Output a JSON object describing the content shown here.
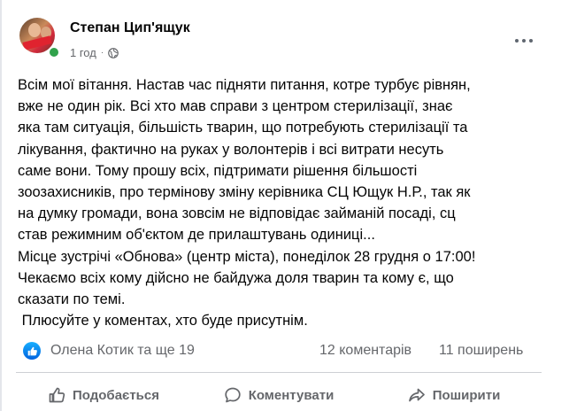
{
  "post": {
    "author": "Степан Цип'ящук",
    "time": "1 год",
    "time_separator": "·",
    "body_lines": [
      "Всім мої вітання. Настав час підняти питання, котре турбує рівнян,",
      "вже не один рік. Всі хто мав справи з центром стерилізації, знає",
      "яка там ситуація, більшість тварин, що потребують стерилізації та",
      "лікування, фактично на руках у волонтерів і всі витрати несуть",
      "саме вони. Тому прошу всіх, підтримати рішення більшості",
      "зоозахисників, про термінову зміну керівника СЦ Ющук Н.Р., так як",
      "на думку громади, вона зовсім не відповідає займаній посаді, сц",
      "став режимним об'єктом де прилаштувань одиниці...",
      "Місце зустрічі «Обнова» (центр міста), понеділок 28 грудня о 17:00!",
      "Чекаємо всіх кому дійсно не байдужа доля тварин та кому є, що",
      "сказати по темі.",
      " Плюсуйте у коментах, хто буде присутнім."
    ]
  },
  "stats": {
    "reactors": "Олена Котик та ще 19",
    "comments": "12 коментарів",
    "shares": "11 поширень"
  },
  "actions": {
    "like": "Подобається",
    "comment": "Коментувати",
    "share": "Поширити"
  },
  "colors": {
    "accent": "#1877f2",
    "secondary_text": "#65676b",
    "online": "#31a24c"
  },
  "icons": {
    "more": "more-dots-icon",
    "privacy": "globe-icon",
    "reaction": "like-reaction-icon",
    "like": "thumbs-up-icon",
    "comment": "comment-bubble-icon",
    "share": "share-arrow-icon"
  }
}
